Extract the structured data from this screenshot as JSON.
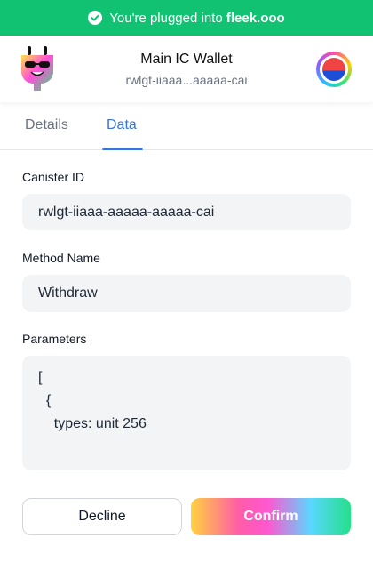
{
  "banner": {
    "prefix": "You're plugged into ",
    "site": "fleek.ooo",
    "color": "#10c271"
  },
  "header": {
    "title": "Main IC Wallet",
    "principal": "rwlgt-iiaaa...aaaaa-cai"
  },
  "tabs": [
    {
      "label": "Details",
      "active": false
    },
    {
      "label": "Data",
      "active": true
    }
  ],
  "fields": {
    "canister_id": {
      "label": "Canister ID",
      "value": "rwlgt-iiaaa-aaaaa-aaaaa-cai"
    },
    "method_name": {
      "label": "Method Name",
      "value": "Withdraw"
    },
    "parameters": {
      "label": "Parameters",
      "lines": [
        "[",
        "  {",
        "    types: unit 256"
      ]
    }
  },
  "actions": {
    "decline": "Decline",
    "confirm": "Confirm"
  },
  "colors": {
    "accent": "#3b73d8",
    "banner": "#10c271"
  }
}
